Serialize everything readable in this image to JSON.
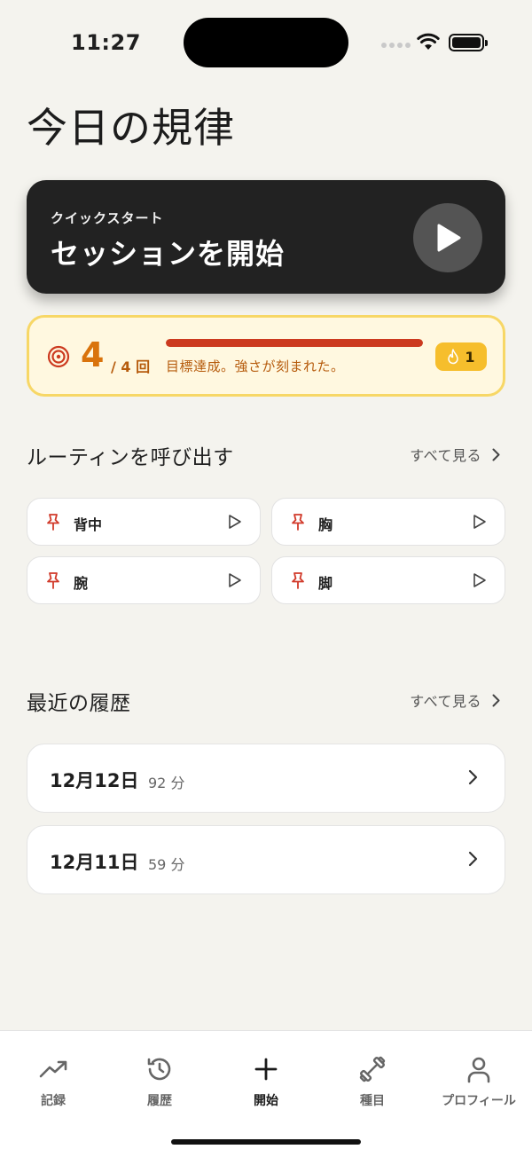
{
  "status_bar": {
    "time": "11:27"
  },
  "page_title": "今日の規律",
  "quick_start": {
    "eyebrow": "クイックスタート",
    "title": "セッションを開始"
  },
  "goal": {
    "count": "4",
    "total": "/ 4 回",
    "progress": 1.0,
    "message": "目標達成。強さが刻まれた。",
    "streak": "1",
    "colors": {
      "accent": "#d9730c",
      "bar": "#cc3a1f",
      "badge": "#f6be2c"
    }
  },
  "routines": {
    "title": "ルーティンを呼び出す",
    "see_all": "すべて見る",
    "items": [
      {
        "label": "背中"
      },
      {
        "label": "胸"
      },
      {
        "label": "腕"
      },
      {
        "label": "脚"
      }
    ]
  },
  "history": {
    "title": "最近の履歴",
    "see_all": "すべて見る",
    "items": [
      {
        "date": "12月12日",
        "duration": "92 分"
      },
      {
        "date": "12月11日",
        "duration": "59 分"
      }
    ]
  },
  "tab_bar": {
    "tabs": [
      {
        "label": "記録",
        "icon": "trending-up-icon"
      },
      {
        "label": "履歴",
        "icon": "history-icon"
      },
      {
        "label": "開始",
        "icon": "plus-icon",
        "active": true
      },
      {
        "label": "種目",
        "icon": "dumbbell-icon"
      },
      {
        "label": "プロフィール",
        "icon": "person-icon"
      }
    ]
  }
}
